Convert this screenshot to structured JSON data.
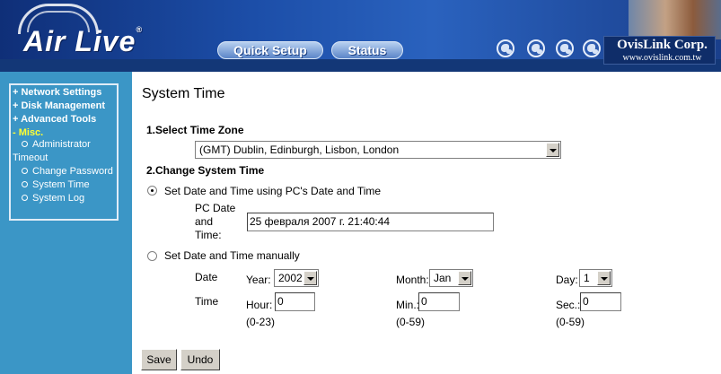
{
  "header": {
    "logo_text": "Air Live",
    "logo_mark": "®",
    "nav": [
      "Quick Setup",
      "Status"
    ],
    "globe_icons": [
      "globe-icon",
      "globe-icon",
      "globe-icon",
      "globe-icon"
    ],
    "brand": "OvisLink Corp.",
    "brand_url": "www.ovislink.com.tw"
  },
  "sidebar": {
    "items": [
      {
        "label": "+ Network Settings"
      },
      {
        "label": "+ Disk Management"
      },
      {
        "label": "+ Advanced Tools"
      },
      {
        "label": "- Misc."
      }
    ],
    "sub_items": [
      {
        "label": "Administrator"
      },
      {
        "label": "Timeout"
      },
      {
        "label": "Change Password"
      },
      {
        "label": "System Time"
      },
      {
        "label": "System Log"
      }
    ],
    "colors": {
      "background": "#3b96c6",
      "active": "#ffff33"
    }
  },
  "page": {
    "title": "System Time",
    "section1": "1.Select Time Zone",
    "timezone": "(GMT) Dublin, Edinburgh, Lisbon, London",
    "section2": "2.Change System Time",
    "opt_pc": "Set Date and Time using PC's Date and Time",
    "pc_label_1": "PC Date",
    "pc_label_2": "and",
    "pc_label_3": "Time:",
    "pc_value": "25 февраля 2007 г. 21:40:44",
    "opt_manual": "Set Date and Time manually",
    "date_label": "Date",
    "time_label": "Time",
    "year_label": "Year:",
    "year_value": "2002",
    "month_label": "Month:",
    "month_value": "Jan",
    "day_label": "Day:",
    "day_value": "1",
    "hour_label": "Hour:",
    "hour_value": "0",
    "min_label": "Min.:",
    "min_value": "0",
    "sec_label": "Sec.:",
    "sec_value": "0",
    "hour_range": "(0-23)",
    "min_range": "(0-59)",
    "sec_range": "(0-59)",
    "save": "Save",
    "undo": "Undo",
    "selected_option": "pc"
  }
}
